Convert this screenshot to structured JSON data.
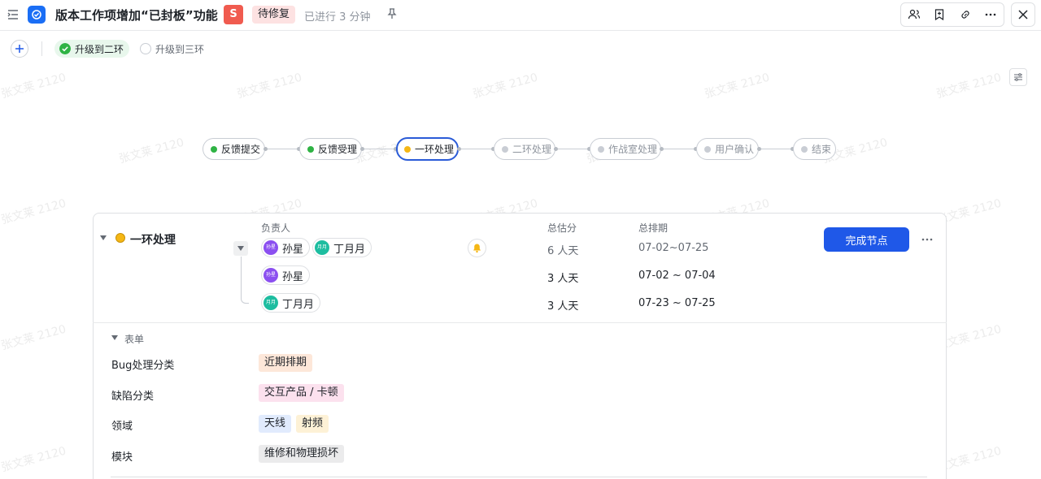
{
  "header": {
    "title": "版本工作项增加“已封板”功能",
    "severity": "S",
    "status": "待修复",
    "elapsed": "已进行 3 分钟"
  },
  "toolbar": {
    "level2_label": "升级到二环",
    "level3_label": "升级到三环"
  },
  "workflow": {
    "nodes": [
      {
        "label": "反馈提交",
        "state": "done"
      },
      {
        "label": "反馈受理",
        "state": "done"
      },
      {
        "label": "一环处理",
        "state": "current"
      },
      {
        "label": "二环处理",
        "state": "pending"
      },
      {
        "label": "作战室处理",
        "state": "pending"
      },
      {
        "label": "用户确认",
        "state": "pending"
      },
      {
        "label": "结束",
        "state": "pending"
      }
    ]
  },
  "node_card": {
    "title": "一环处理",
    "col_owner": "负责人",
    "col_estimate": "总估分",
    "col_schedule": "总排期",
    "complete_button": "完成节点",
    "summary": {
      "owners": [
        {
          "avatar": "孙星",
          "name": "孙星"
        },
        {
          "avatar": "月月",
          "name": "丁月月"
        }
      ],
      "estimate": "6 人天",
      "schedule": "07-02~07-25"
    },
    "rows": [
      {
        "avatar": "孙星",
        "name": "孙星",
        "estimate": "3 人天",
        "schedule": "07-02 ~ 07-04"
      },
      {
        "avatar": "月月",
        "name": "丁月月",
        "estimate": "3 人天",
        "schedule": "07-23 ~ 07-25"
      }
    ]
  },
  "form": {
    "title": "表单",
    "fields": [
      {
        "label": "Bug处理分类",
        "tags": [
          "近期排期"
        ]
      },
      {
        "label": "缺陷分类",
        "tags": [
          "交互产品 / 卡顿"
        ]
      },
      {
        "label": "领域",
        "tags": [
          "天线",
          "射频"
        ]
      },
      {
        "label": "模块",
        "tags": [
          "维修和物理损坏"
        ]
      }
    ]
  },
  "watermark": "张文莱 2120",
  "colors": {
    "accent": "#1f58e8",
    "done": "#2fb344",
    "current": "#f5b715",
    "severity": "#f05b4f"
  }
}
